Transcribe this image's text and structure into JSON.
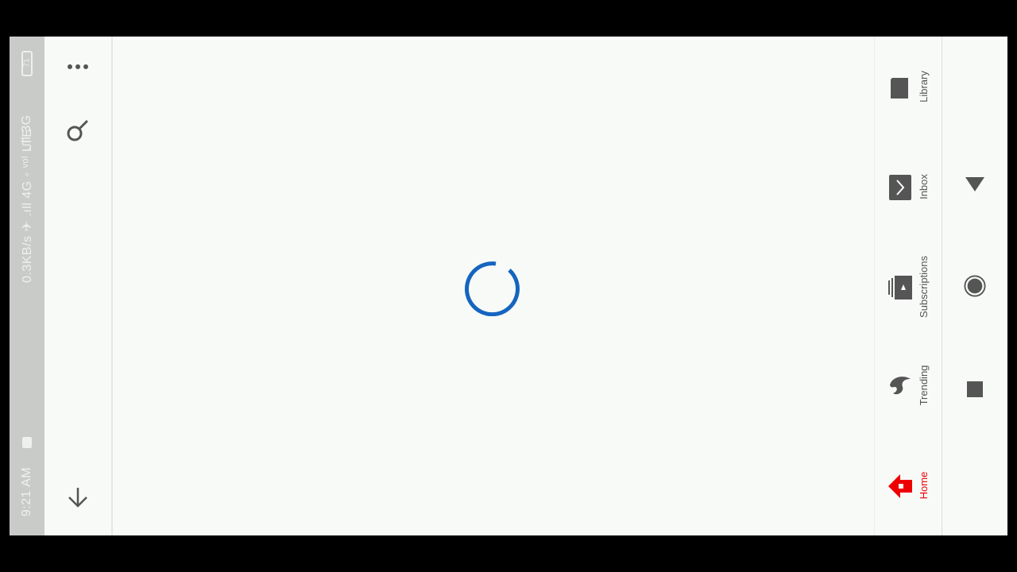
{
  "status_bar": {
    "time": "9:21 AM",
    "network": "0.3KB/s ✈ .ıll 4G ◦ ᵛᵒˡ LTE",
    "signal": ".ıll 3G",
    "battery": "71"
  },
  "toolbar": {
    "more_icon": "more-dots-icon",
    "search_icon": "search-icon",
    "download_icon": "arrow-down-icon"
  },
  "content": {
    "loading": true,
    "spinner_color": "#1565c0"
  },
  "bottom_nav": {
    "items": [
      {
        "label": "Library",
        "icon": "library-icon"
      },
      {
        "label": "Inbox",
        "icon": "inbox-icon"
      },
      {
        "label": "Subscriptions",
        "icon": "subscriptions-icon"
      },
      {
        "label": "Trending",
        "icon": "trending-icon"
      },
      {
        "label": "Home",
        "icon": "home-icon",
        "active": true
      }
    ],
    "active_color": "#ee0000",
    "inactive_color": "#555555"
  },
  "system_nav": {
    "back_icon": "back-triangle-icon",
    "home_icon": "home-circle-icon",
    "recents_icon": "recents-square-icon"
  }
}
